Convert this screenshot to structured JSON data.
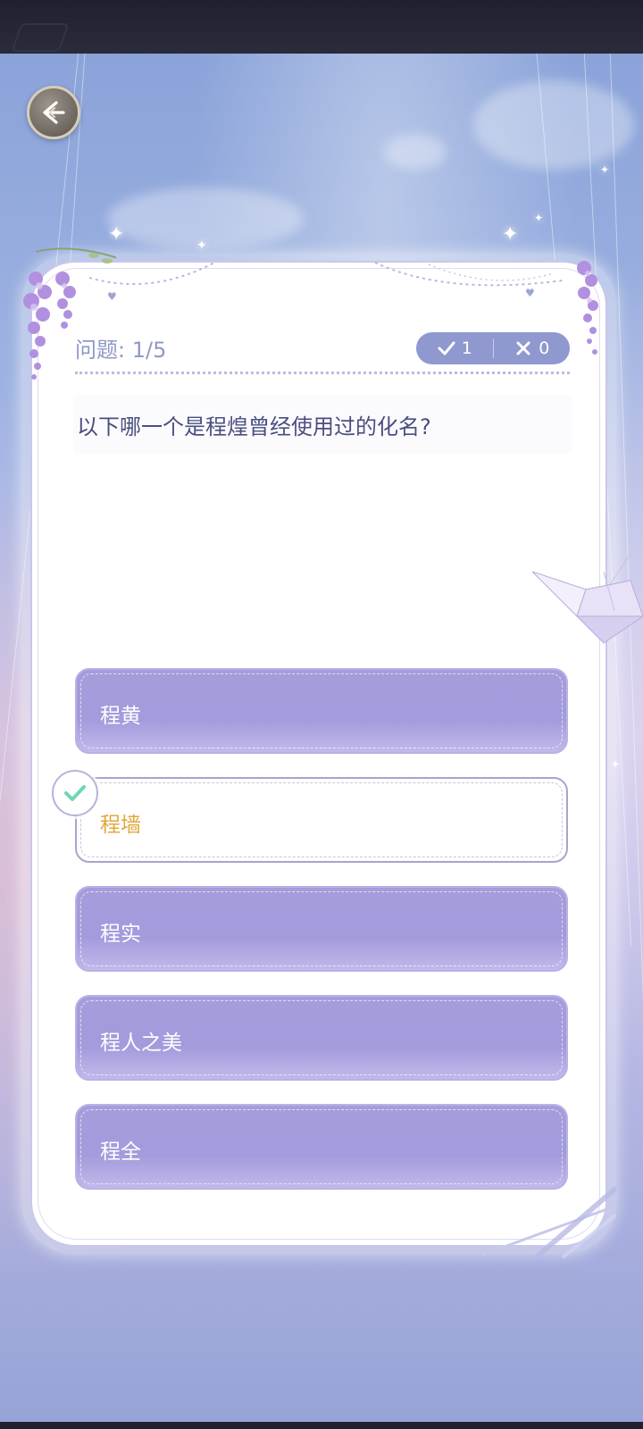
{
  "quiz": {
    "progress_label": "问题: 1/5",
    "correct_count": "1",
    "wrong_count": "0",
    "question": "以下哪一个是程煌曾经使用过的化名?",
    "options": [
      {
        "label": "程黄"
      },
      {
        "label": "程墙"
      },
      {
        "label": "程实"
      },
      {
        "label": "程人之美"
      },
      {
        "label": "程全"
      }
    ],
    "selected_index": 1
  },
  "icons": {
    "back": "back-arrow-icon",
    "correct": "check-icon",
    "wrong": "cross-icon",
    "selected": "checkmark-icon"
  },
  "colors": {
    "option_fill": "#a29bdc",
    "selected_text": "#e0a93c",
    "badge": "#8f98cf",
    "check": "#6fd6b8"
  }
}
